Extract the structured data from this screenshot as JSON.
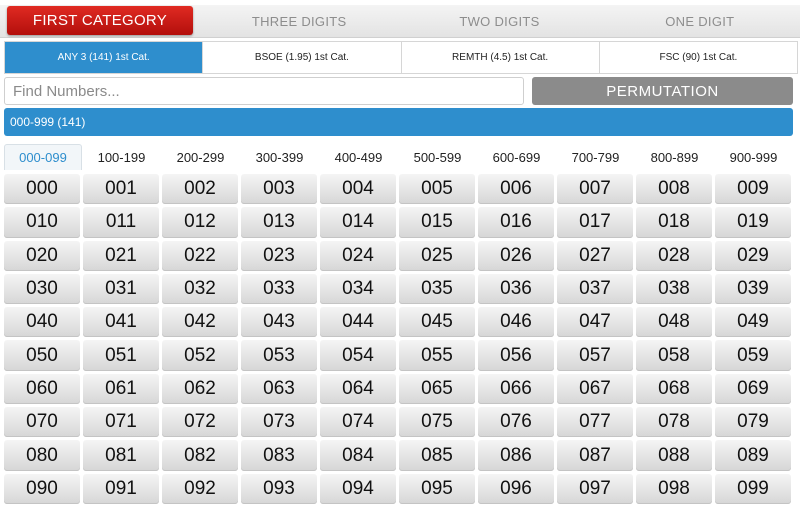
{
  "categories": [
    {
      "label": "FIRST CATEGORY",
      "active": true
    },
    {
      "label": "THREE DIGITS",
      "active": false
    },
    {
      "label": "TWO DIGITS",
      "active": false
    },
    {
      "label": "ONE DIGIT",
      "active": false
    }
  ],
  "subtabs": [
    {
      "label": "ANY 3 (141) 1st Cat.",
      "active": true
    },
    {
      "label": "BSOE (1.95) 1st Cat.",
      "active": false
    },
    {
      "label": "REMTH (4.5) 1st Cat.",
      "active": false
    },
    {
      "label": "FSC (90) 1st Cat.",
      "active": false
    }
  ],
  "search": {
    "placeholder": "Find Numbers...",
    "value": ""
  },
  "permutation_label": "PERMUTATION",
  "section_label": "000-999 (141)",
  "ranges": [
    "000-099",
    "100-199",
    "200-299",
    "300-399",
    "400-499",
    "500-599",
    "600-699",
    "700-799",
    "800-899",
    "900-999"
  ],
  "active_range": "000-099",
  "numbers": [
    "000",
    "001",
    "002",
    "003",
    "004",
    "005",
    "006",
    "007",
    "008",
    "009",
    "010",
    "011",
    "012",
    "013",
    "014",
    "015",
    "016",
    "017",
    "018",
    "019",
    "020",
    "021",
    "022",
    "023",
    "024",
    "025",
    "026",
    "027",
    "028",
    "029",
    "030",
    "031",
    "032",
    "033",
    "034",
    "035",
    "036",
    "037",
    "038",
    "039",
    "040",
    "041",
    "042",
    "043",
    "044",
    "045",
    "046",
    "047",
    "048",
    "049",
    "050",
    "051",
    "052",
    "053",
    "054",
    "055",
    "056",
    "057",
    "058",
    "059",
    "060",
    "061",
    "062",
    "063",
    "064",
    "065",
    "066",
    "067",
    "068",
    "069",
    "070",
    "071",
    "072",
    "073",
    "074",
    "075",
    "076",
    "077",
    "078",
    "079",
    "080",
    "081",
    "082",
    "083",
    "084",
    "085",
    "086",
    "087",
    "088",
    "089",
    "090",
    "091",
    "092",
    "093",
    "094",
    "095",
    "096",
    "097",
    "098",
    "099"
  ],
  "colors": {
    "accent_blue": "#2e8ecd",
    "active_red": "#c81a15",
    "button_gray": "#8b8b8b"
  }
}
